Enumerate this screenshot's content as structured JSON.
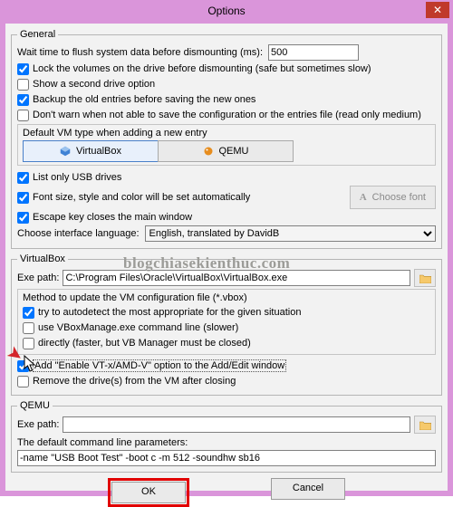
{
  "title": "Options",
  "general": {
    "legend": "General",
    "wait_label": "Wait time to flush system data before dismounting (ms):",
    "wait_value": "500",
    "lock": "Lock the volumes on the drive before dismounting (safe but sometimes slow)",
    "second_drive": "Show a second drive option",
    "backup": "Backup the old entries before saving the new ones",
    "nowarn": "Don't warn when not able to save the configuration or the entries file (read only medium)",
    "default_vm_label": "Default VM type when adding a new entry",
    "vbox_btn": "VirtualBox",
    "qemu_btn": "QEMU",
    "list_usb": "List only USB drives",
    "font_auto": "Font size, style and color will be set automatically",
    "choose_font": "Choose font",
    "escape": "Escape key closes the main window",
    "lang_label": "Choose interface language:",
    "lang_value": "English, translated by DavidB"
  },
  "vbox": {
    "legend": "VirtualBox",
    "exepath_label": "Exe path:",
    "exepath_value": "C:\\Program Files\\Oracle\\VirtualBox\\VirtualBox.exe",
    "method_label": "Method to update the VM configuration file (*.vbox)",
    "autodetect": "try to autodetect the most appropriate for the given situation",
    "vboxmanage": "use VBoxManage.exe command line (slower)",
    "directly": "directly (faster, but VB Manager must be closed)",
    "enablevt": "Add \"Enable VT-x/AMD-V\" option to the Add/Edit window",
    "removedrive": "Remove the drive(s) from the VM after closing"
  },
  "qemu": {
    "legend": "QEMU",
    "exepath_label": "Exe path:",
    "exepath_value": "",
    "cmdline_label": "The default command line parameters:",
    "cmdline_value": "-name \"USB Boot Test\" -boot c -m 512 -soundhw sb16"
  },
  "buttons": {
    "ok": "OK",
    "cancel": "Cancel"
  },
  "watermark": "blogchiasekienthuc.com"
}
